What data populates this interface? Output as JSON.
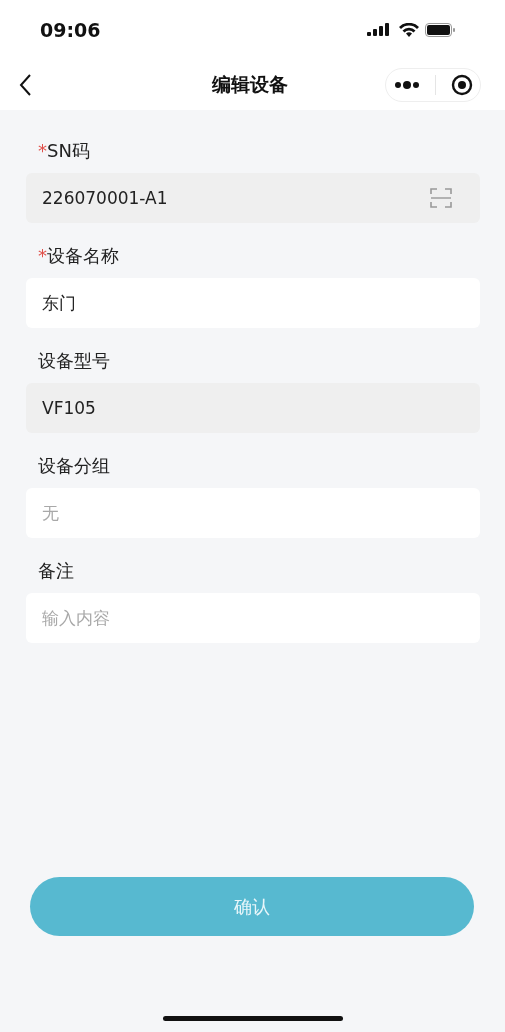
{
  "status_bar": {
    "time": "09:06"
  },
  "nav": {
    "title": "编辑设备"
  },
  "required_mark": "*",
  "fields": [
    {
      "label": "SN码",
      "required": true,
      "kind": "scan",
      "disabled": true,
      "value": "226070001-A1"
    },
    {
      "label": "设备名称",
      "required": true,
      "kind": "text",
      "disabled": false,
      "value": "东门"
    },
    {
      "label": "设备型号",
      "required": false,
      "kind": "text",
      "disabled": true,
      "value": "VF105"
    },
    {
      "label": "设备分组",
      "required": false,
      "kind": "select",
      "disabled": false,
      "placeholder": "无"
    },
    {
      "label": "备注",
      "required": false,
      "kind": "text",
      "disabled": false,
      "placeholder": "输入内容"
    }
  ],
  "confirm_button": {
    "label": "确认",
    "disabled": true
  }
}
